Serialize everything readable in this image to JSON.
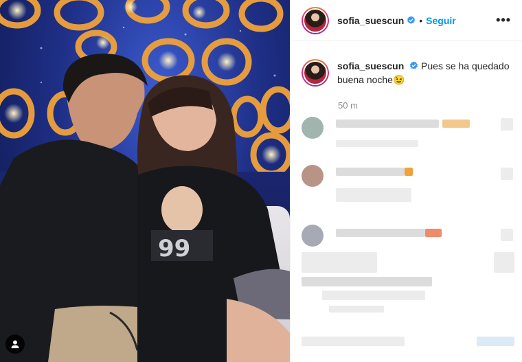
{
  "post": {
    "username": "sofia_suescun",
    "follow_label": "Seguir",
    "separator": "•",
    "more_label": "•••",
    "caption": "Pues se ha quedado buena noche",
    "caption_emoji": "😉",
    "timestamp": "50 m"
  },
  "icons": {
    "verified": "verified-badge-icon",
    "user_tag": "user-tag-icon",
    "more": "more-options-icon"
  },
  "colors": {
    "accent": "#0095f6",
    "verified": "#3897f0",
    "muted": "#8e8e8e",
    "text": "#262626",
    "stage_blue": "#1e2f86",
    "lamp_orange": "#f0a23a"
  }
}
